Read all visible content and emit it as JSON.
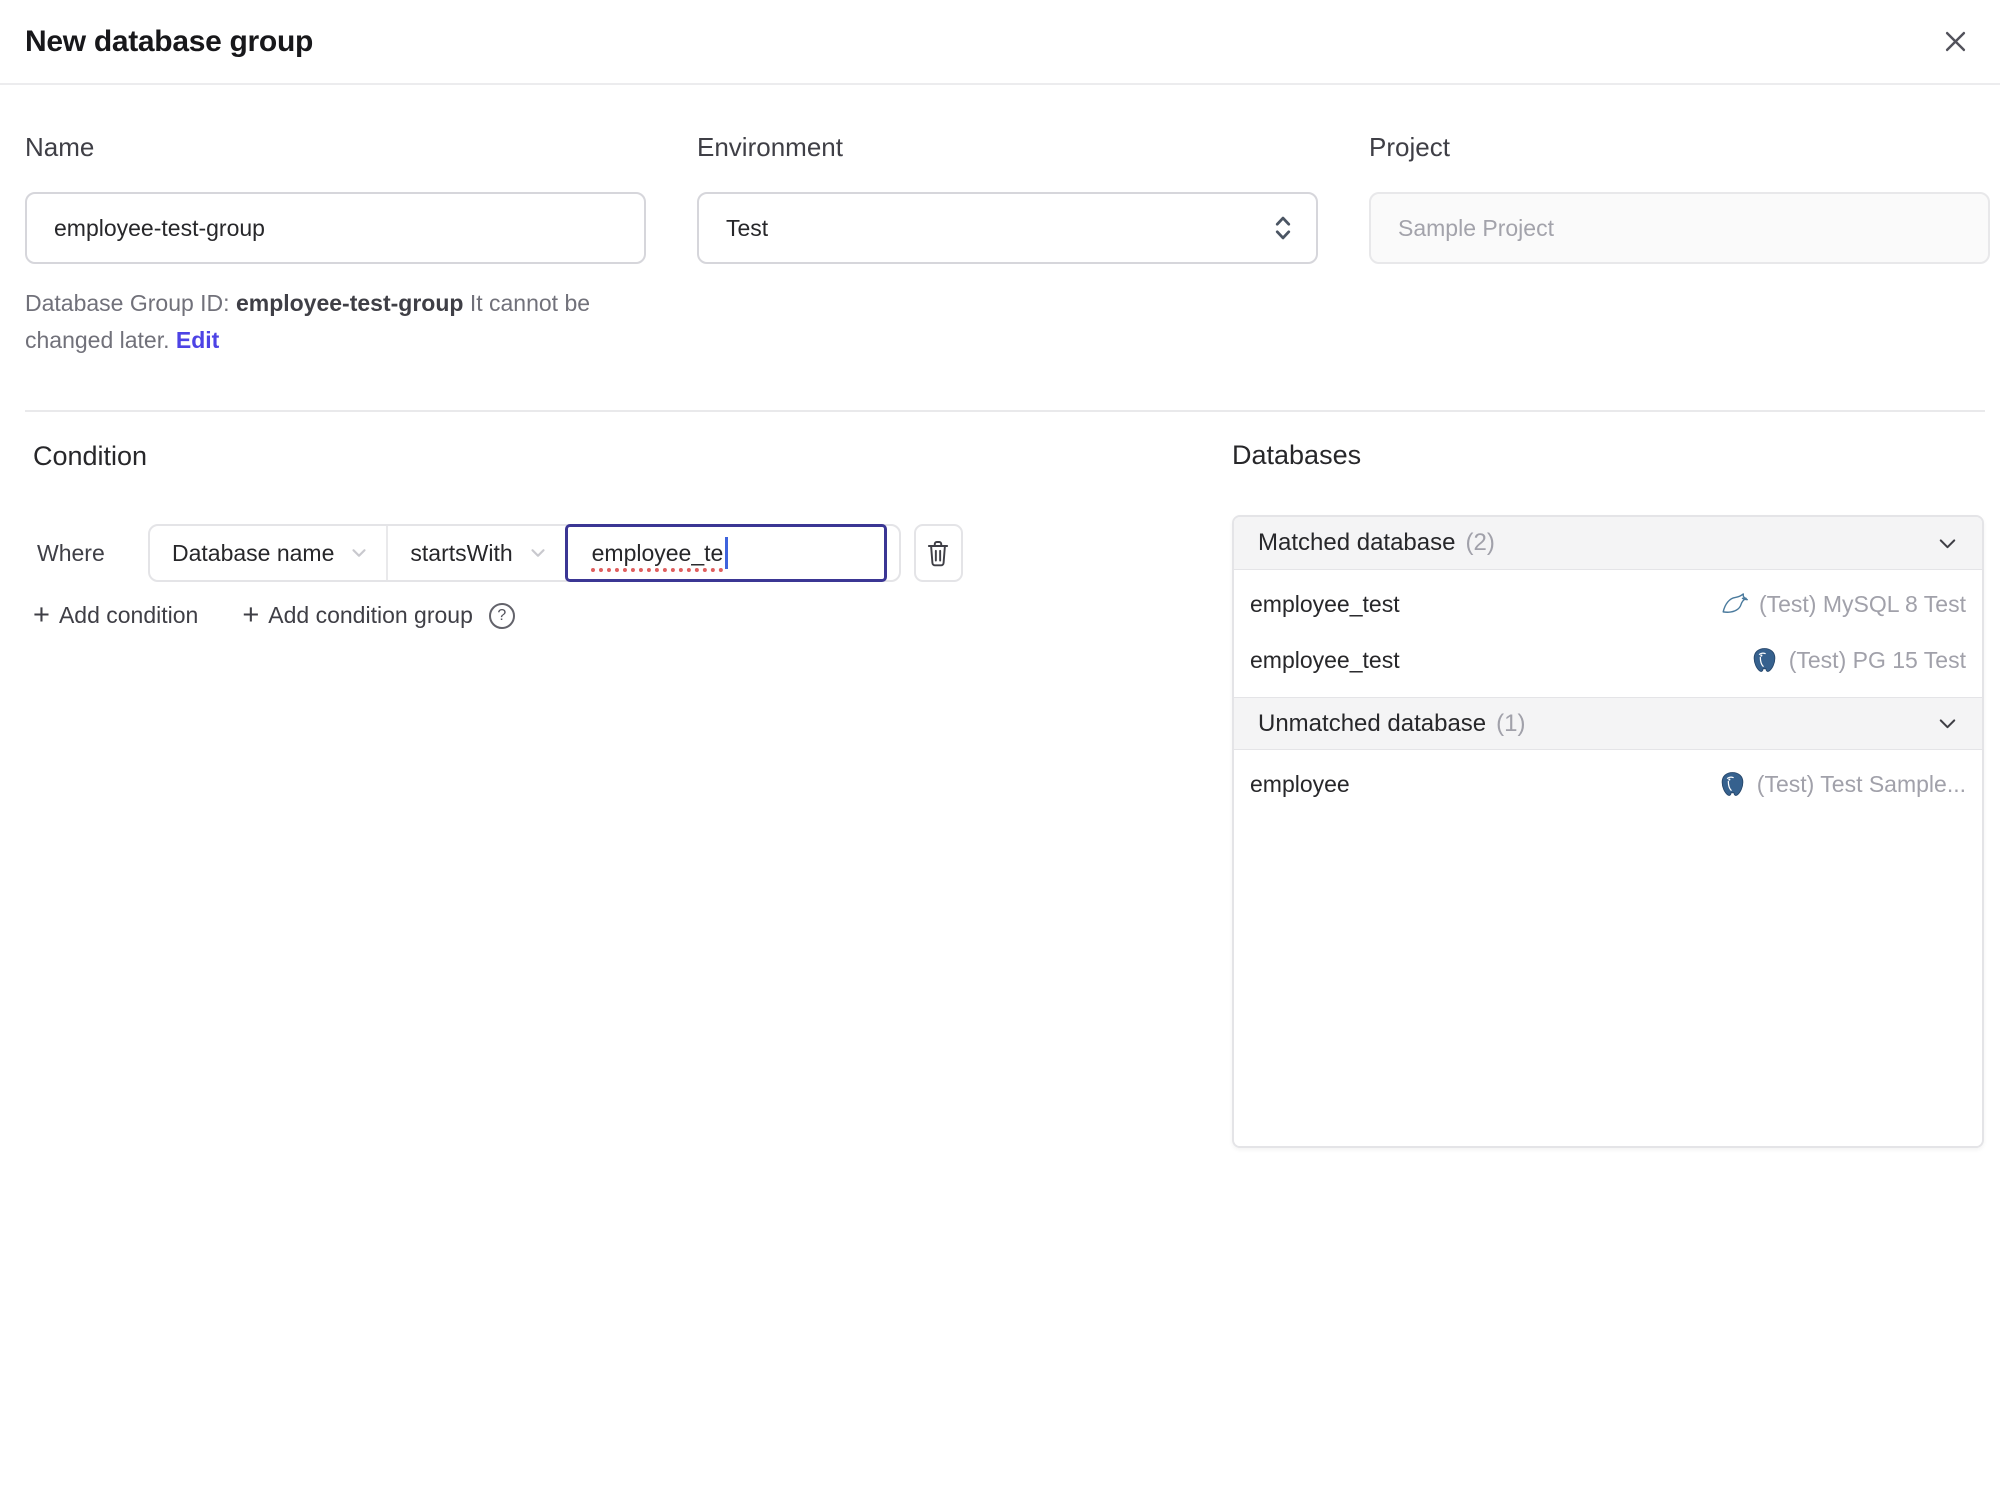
{
  "dialog": {
    "title": "New database group"
  },
  "form": {
    "name": {
      "label": "Name",
      "value": "employee-test-group"
    },
    "environment": {
      "label": "Environment",
      "value": "Test"
    },
    "project": {
      "label": "Project",
      "value": "Sample Project"
    },
    "id_hint": {
      "prefix": "Database Group ID: ",
      "id": "employee-test-group",
      "suffix": " It cannot be changed later. ",
      "edit_label": "Edit"
    }
  },
  "condition": {
    "heading": "Condition",
    "where_label": "Where",
    "field_selected": "Database name",
    "operator_selected": "startsWith",
    "value": "employee_te",
    "add_condition_label": "Add condition",
    "add_condition_group_label": "Add condition group",
    "help_glyph": "?"
  },
  "databases": {
    "heading": "Databases",
    "matched": {
      "label": "Matched database",
      "count_display": "(2)",
      "rows": [
        {
          "name": "employee_test",
          "engine": "mysql",
          "instance": "(Test) MySQL 8 Test"
        },
        {
          "name": "employee_test",
          "engine": "postgres",
          "instance": "(Test) PG 15 Test"
        }
      ]
    },
    "unmatched": {
      "label": "Unmatched database",
      "count_display": "(1)",
      "rows": [
        {
          "name": "employee",
          "engine": "postgres",
          "instance": "(Test) Test Sample..."
        }
      ]
    }
  },
  "icons": {
    "close": "x-cross",
    "select_updown": "chevron-up-down",
    "select_chevron": "chevron-down",
    "trash": "trash-can-outline",
    "plus": "+",
    "section_chevron": "chevron-down",
    "mysql": "mysql-dolphin",
    "postgres": "postgres-elephant"
  },
  "colors": {
    "accent_indigo": "#4d43e5",
    "focus_border": "#3b3694",
    "caret_blue": "#3e63dd",
    "misspell_red": "#df5f5f",
    "muted_text": "#a1a1aa",
    "header_bg": "#f4f4f5",
    "border": "#e4e4e7",
    "mysql_blue": "#4a7a9d",
    "postgres_blue": "#36618e"
  }
}
